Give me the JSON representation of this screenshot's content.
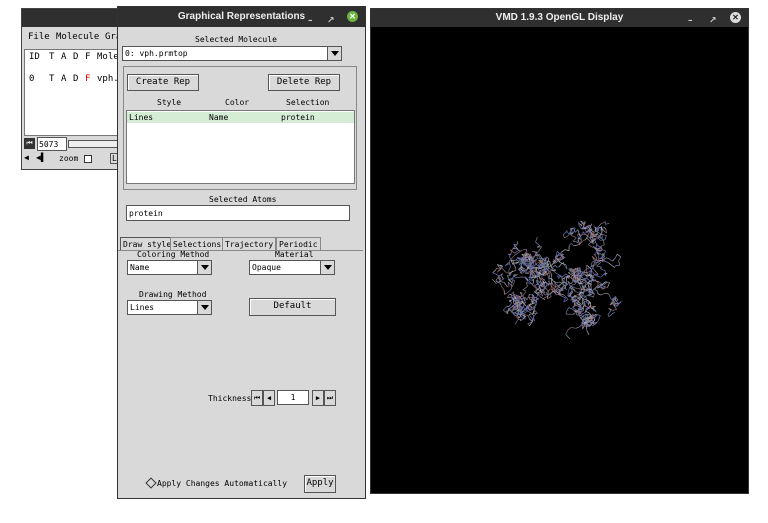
{
  "main_window": {
    "menu": [
      "File",
      "Molecule",
      "Gra"
    ],
    "columns": [
      "ID",
      "T",
      "A",
      "D",
      "F",
      "Mole"
    ],
    "row": {
      "id": "0",
      "t": "T",
      "a": "A",
      "d": "D",
      "f": "F",
      "name": "vph."
    },
    "frame_value": "5073",
    "zoom_label": "zoom",
    "loop_initial": "L"
  },
  "reps": {
    "title": "Graphical Representations",
    "selected_molecule_label": "Selected Molecule",
    "selected_molecule": "0: vph.prmtop",
    "create_rep": "Create Rep",
    "delete_rep": "Delete Rep",
    "table_headers": {
      "style": "Style",
      "color": "Color",
      "selection": "Selection"
    },
    "rows": [
      {
        "style": "Lines",
        "color": "Name",
        "selection": "protein"
      }
    ],
    "selected_atoms_label": "Selected Atoms",
    "selected_atoms": "protein",
    "tabs": [
      "Draw style",
      "Selections",
      "Trajectory",
      "Periodic"
    ],
    "coloring_method_label": "Coloring Method",
    "coloring_method": "Name",
    "material_label": "Material",
    "material": "Opaque",
    "drawing_method_label": "Drawing Method",
    "drawing_method": "Lines",
    "default_button": "Default",
    "thickness_label": "Thickness",
    "thickness_value": "1",
    "apply_auto_label": "Apply Changes Automatically",
    "apply_button": "Apply"
  },
  "display": {
    "title": "VMD 1.9.3 OpenGL Display",
    "background": "#000000"
  },
  "window_controls": {
    "minimize": "–",
    "restore": "↗",
    "close": "✕"
  }
}
